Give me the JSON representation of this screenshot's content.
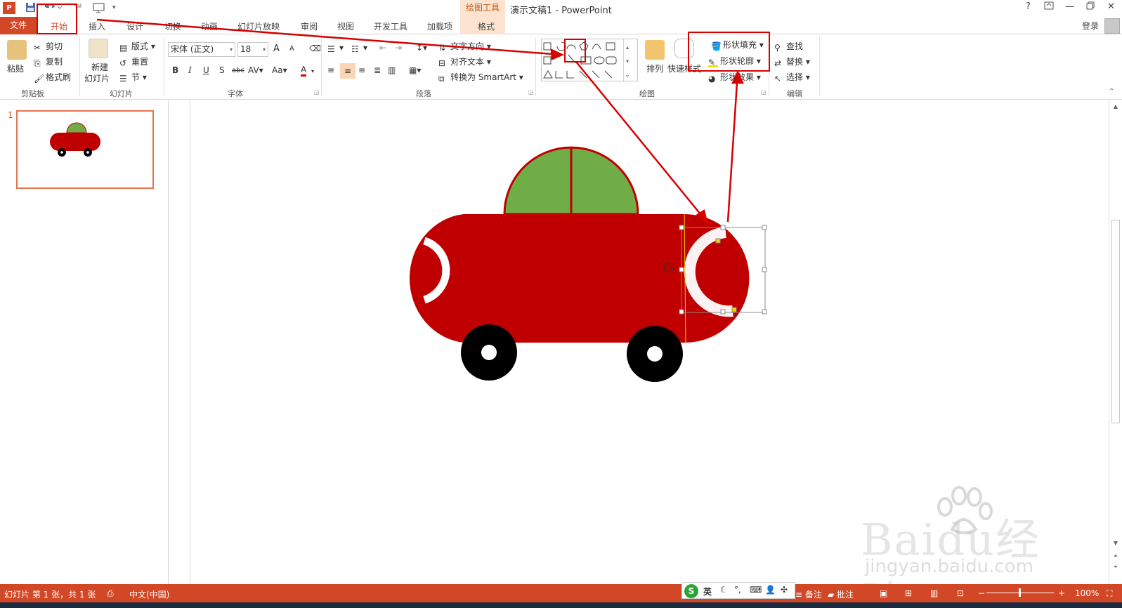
{
  "title_bar": {
    "app_icon": "P",
    "context_tools": "绘图工具",
    "doc_title": "演示文稿1 - PowerPoint",
    "help": "?",
    "restore": "🗗",
    "minimize": "—",
    "maximize": "🗖",
    "close": "✕"
  },
  "tabs": {
    "file": "文件",
    "items": [
      "开始",
      "插入",
      "设计",
      "切换",
      "动画",
      "幻灯片放映",
      "审阅",
      "视图",
      "开发工具",
      "加载项",
      "格式"
    ],
    "login": "登录"
  },
  "ribbon": {
    "clipboard": {
      "paste": "粘贴",
      "cut": "剪切",
      "copy": "复制",
      "format_painter": "格式刷",
      "group": "剪贴板"
    },
    "slides": {
      "new_slide": "新建\n幻灯片",
      "new_slide_line1": "新建",
      "new_slide_line2": "幻灯片",
      "layout": "版式",
      "reset": "重置",
      "section": "节",
      "group": "幻灯片"
    },
    "font": {
      "font_name": "宋体 (正文)",
      "font_size": "18",
      "bold": "B",
      "italic": "I",
      "underline": "U",
      "shadow": "S",
      "strike": "abc",
      "spacing": "AV",
      "case": "Aa",
      "color": "A",
      "grow": "A",
      "shrink": "A",
      "group": "字体"
    },
    "paragraph": {
      "text_direction": "文字方向",
      "align_text": "对齐文本",
      "smartart": "转换为 SmartArt",
      "group": "段落"
    },
    "drawing": {
      "arrange": "排列",
      "quick_styles": "快速样式",
      "shape_fill": "形状填充",
      "shape_outline": "形状轮廓",
      "shape_effects": "形状效果",
      "group": "绘图"
    },
    "editing": {
      "find": "查找",
      "replace": "替换",
      "select": "选择",
      "group": "编辑"
    }
  },
  "slide_panel": {
    "slide_number": "1"
  },
  "status_bar": {
    "slide_info": "幻灯片 第 1 张，共 1 张",
    "language": "中文(中国)",
    "notes": "备注",
    "comments": "批注",
    "zoom": "100%"
  },
  "ime": {
    "logo": "S",
    "lang": "英"
  },
  "watermark": {
    "text": "Baidu经验",
    "url": "jingyan.baidu.com"
  },
  "colors": {
    "accent": "#d24726",
    "car_body": "#c00000",
    "car_roof": "#70ad47",
    "annotation": "#d60000"
  }
}
